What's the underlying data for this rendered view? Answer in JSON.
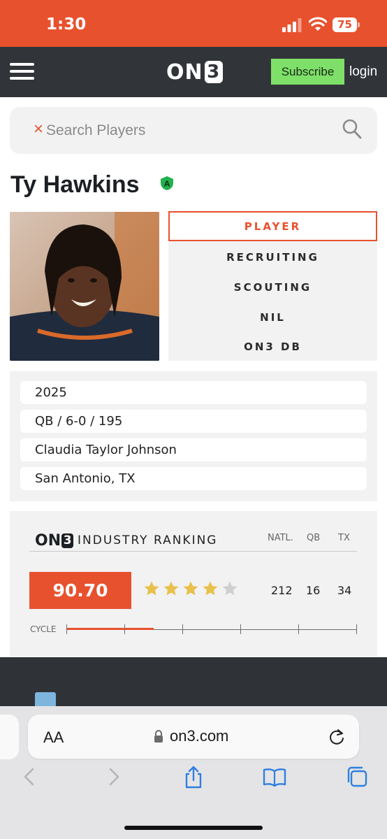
{
  "status_bar": {
    "time": "1:30",
    "battery": "75"
  },
  "nav": {
    "logo_text": "ON",
    "logo_number": "3",
    "subscribe_label": "Subscribe",
    "login_label": "login"
  },
  "search": {
    "placeholder": "Search Players",
    "clear_symbol": "×"
  },
  "player": {
    "name": "Ty Hawkins",
    "badge_letter": "A",
    "tabs": [
      "PLAYER",
      "RECRUITING",
      "SCOUTING",
      "NIL",
      "ON3 DB"
    ],
    "active_tab": "PLAYER",
    "info": [
      "2025",
      "QB / 6-0 / 195",
      "Claudia Taylor Johnson",
      "San Antonio, TX"
    ]
  },
  "ranking": {
    "logo_text": "ON",
    "logo_number": "3",
    "title": "INDUSTRY RANKING",
    "columns": [
      "NATL.",
      "QB",
      "TX"
    ],
    "rating": "90.70",
    "stars": 4,
    "max_stars": 5,
    "values": [
      "212",
      "16",
      "34"
    ],
    "cycle_label": "CYCLE",
    "cycle_progress": 0.3,
    "colors": {
      "accent": "#e8512e",
      "star": "#e8c04a",
      "star_empty": "#cfcfcf"
    }
  },
  "browser": {
    "aa_label": "AA",
    "url": "on3.com"
  }
}
